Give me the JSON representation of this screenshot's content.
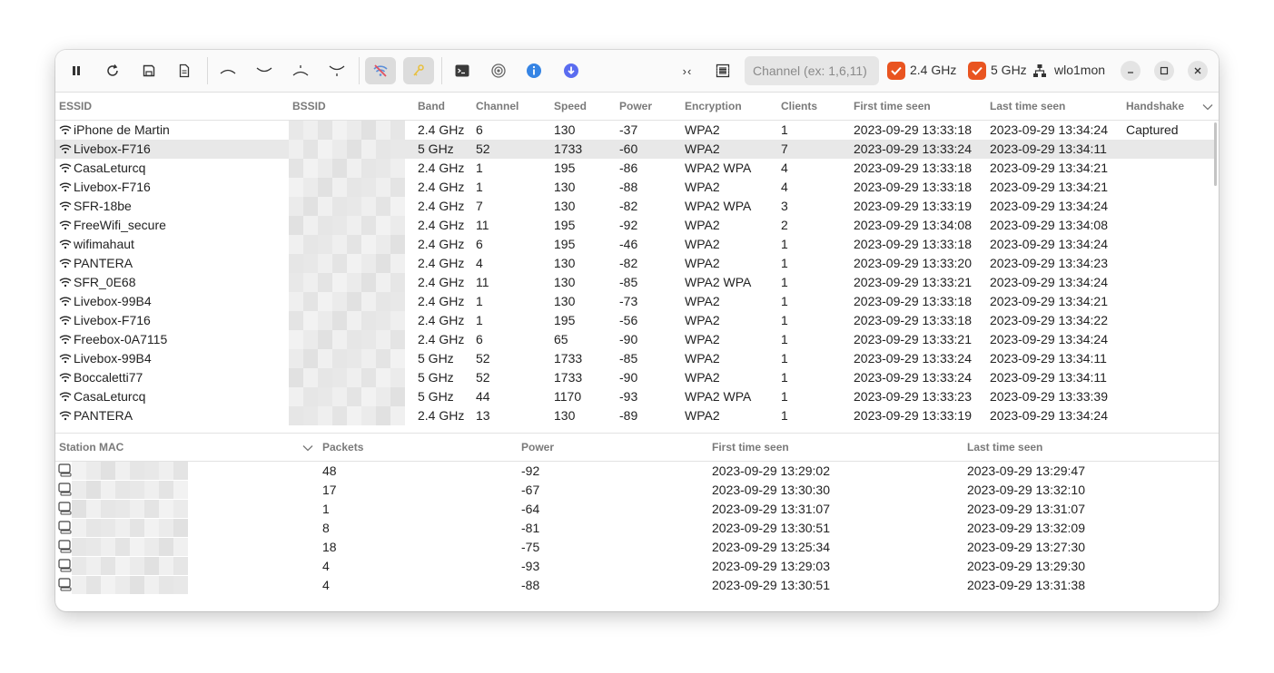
{
  "toolbar": {
    "icons": [
      "pause-icon",
      "refresh-icon",
      "save-icon",
      "document-icon",
      "chevron-up-icon",
      "chevron-down-icon",
      "arrow-up-bar-icon",
      "arrow-down-bar-icon",
      "wifi-off-icon",
      "key-icon",
      "terminal-icon",
      "radar-icon",
      "info-icon",
      "download-icon",
      "collapse-icon",
      "grid-icon"
    ],
    "collapse_label": "›‹",
    "channel_placeholder": "Channel (ex: 1,6,11)",
    "band_24_label": "2.4 GHz",
    "band_5_label": "5 GHz",
    "interface_label": "wlo1mon",
    "accent": "#e95420"
  },
  "networks": {
    "columns": [
      "ESSID",
      "BSSID",
      "Band",
      "Channel",
      "Speed",
      "Power",
      "Encryption",
      "Clients",
      "First time seen",
      "Last time seen",
      "Handshake"
    ],
    "rows": [
      {
        "essid": "iPhone de Martin",
        "band": "2.4 GHz",
        "channel": "6",
        "speed": "130",
        "power": "-37",
        "enc": "WPA2",
        "clients": "1",
        "first": "2023-09-29 13:33:18",
        "last": "2023-09-29 13:34:24",
        "handshake": "Captured"
      },
      {
        "essid": "Livebox-F716",
        "band": "5 GHz",
        "channel": "52",
        "speed": "1733",
        "power": "-60",
        "enc": "WPA2",
        "clients": "7",
        "first": "2023-09-29 13:33:24",
        "last": "2023-09-29 13:34:11",
        "handshake": ""
      },
      {
        "essid": "CasaLeturcq",
        "band": "2.4 GHz",
        "channel": "1",
        "speed": "195",
        "power": "-86",
        "enc": "WPA2 WPA",
        "clients": "4",
        "first": "2023-09-29 13:33:18",
        "last": "2023-09-29 13:34:21",
        "handshake": ""
      },
      {
        "essid": "Livebox-F716",
        "band": "2.4 GHz",
        "channel": "1",
        "speed": "130",
        "power": "-88",
        "enc": "WPA2",
        "clients": "4",
        "first": "2023-09-29 13:33:18",
        "last": "2023-09-29 13:34:21",
        "handshake": ""
      },
      {
        "essid": "SFR-18be",
        "band": "2.4 GHz",
        "channel": "7",
        "speed": "130",
        "power": "-82",
        "enc": "WPA2 WPA",
        "clients": "3",
        "first": "2023-09-29 13:33:19",
        "last": "2023-09-29 13:34:24",
        "handshake": ""
      },
      {
        "essid": "FreeWifi_secure",
        "band": "2.4 GHz",
        "channel": "11",
        "speed": "195",
        "power": "-92",
        "enc": "WPA2",
        "clients": "2",
        "first": "2023-09-29 13:34:08",
        "last": "2023-09-29 13:34:08",
        "handshake": ""
      },
      {
        "essid": "wifimahaut",
        "band": "2.4 GHz",
        "channel": "6",
        "speed": "195",
        "power": "-46",
        "enc": "WPA2",
        "clients": "1",
        "first": "2023-09-29 13:33:18",
        "last": "2023-09-29 13:34:24",
        "handshake": ""
      },
      {
        "essid": "PANTERA",
        "band": "2.4 GHz",
        "channel": "4",
        "speed": "130",
        "power": "-82",
        "enc": "WPA2",
        "clients": "1",
        "first": "2023-09-29 13:33:20",
        "last": "2023-09-29 13:34:23",
        "handshake": ""
      },
      {
        "essid": "SFR_0E68",
        "band": "2.4 GHz",
        "channel": "11",
        "speed": "130",
        "power": "-85",
        "enc": "WPA2 WPA",
        "clients": "1",
        "first": "2023-09-29 13:33:21",
        "last": "2023-09-29 13:34:24",
        "handshake": ""
      },
      {
        "essid": "Livebox-99B4",
        "band": "2.4 GHz",
        "channel": "1",
        "speed": "130",
        "power": "-73",
        "enc": "WPA2",
        "clients": "1",
        "first": "2023-09-29 13:33:18",
        "last": "2023-09-29 13:34:21",
        "handshake": ""
      },
      {
        "essid": "Livebox-F716",
        "band": "2.4 GHz",
        "channel": "1",
        "speed": "195",
        "power": "-56",
        "enc": "WPA2",
        "clients": "1",
        "first": "2023-09-29 13:33:18",
        "last": "2023-09-29 13:34:22",
        "handshake": ""
      },
      {
        "essid": "Freebox-0A7115",
        "band": "2.4 GHz",
        "channel": "6",
        "speed": "65",
        "power": "-90",
        "enc": "WPA2",
        "clients": "1",
        "first": "2023-09-29 13:33:21",
        "last": "2023-09-29 13:34:24",
        "handshake": ""
      },
      {
        "essid": "Livebox-99B4",
        "band": "5 GHz",
        "channel": "52",
        "speed": "1733",
        "power": "-85",
        "enc": "WPA2",
        "clients": "1",
        "first": "2023-09-29 13:33:24",
        "last": "2023-09-29 13:34:11",
        "handshake": ""
      },
      {
        "essid": "Boccaletti77",
        "band": "5 GHz",
        "channel": "52",
        "speed": "1733",
        "power": "-90",
        "enc": "WPA2",
        "clients": "1",
        "first": "2023-09-29 13:33:24",
        "last": "2023-09-29 13:34:11",
        "handshake": ""
      },
      {
        "essid": "CasaLeturcq",
        "band": "5 GHz",
        "channel": "44",
        "speed": "1170",
        "power": "-93",
        "enc": "WPA2 WPA",
        "clients": "1",
        "first": "2023-09-29 13:33:23",
        "last": "2023-09-29 13:33:39",
        "handshake": ""
      },
      {
        "essid": "PANTERA",
        "band": "2.4 GHz",
        "channel": "13",
        "speed": "130",
        "power": "-89",
        "enc": "WPA2",
        "clients": "1",
        "first": "2023-09-29 13:33:19",
        "last": "2023-09-29 13:34:24",
        "handshake": ""
      }
    ]
  },
  "stations": {
    "columns": [
      "Station MAC",
      "Packets",
      "Power",
      "First time seen",
      "Last time seen"
    ],
    "rows": [
      {
        "packets": "48",
        "power": "-92",
        "first": "2023-09-29 13:29:02",
        "last": "2023-09-29 13:29:47"
      },
      {
        "packets": "17",
        "power": "-67",
        "first": "2023-09-29 13:30:30",
        "last": "2023-09-29 13:32:10"
      },
      {
        "packets": "1",
        "power": "-64",
        "first": "2023-09-29 13:31:07",
        "last": "2023-09-29 13:31:07"
      },
      {
        "packets": "8",
        "power": "-81",
        "first": "2023-09-29 13:30:51",
        "last": "2023-09-29 13:32:09"
      },
      {
        "packets": "18",
        "power": "-75",
        "first": "2023-09-29 13:25:34",
        "last": "2023-09-29 13:27:30"
      },
      {
        "packets": "4",
        "power": "-93",
        "first": "2023-09-29 13:29:03",
        "last": "2023-09-29 13:29:30"
      },
      {
        "packets": "4",
        "power": "-88",
        "first": "2023-09-29 13:30:51",
        "last": "2023-09-29 13:31:38"
      }
    ]
  }
}
